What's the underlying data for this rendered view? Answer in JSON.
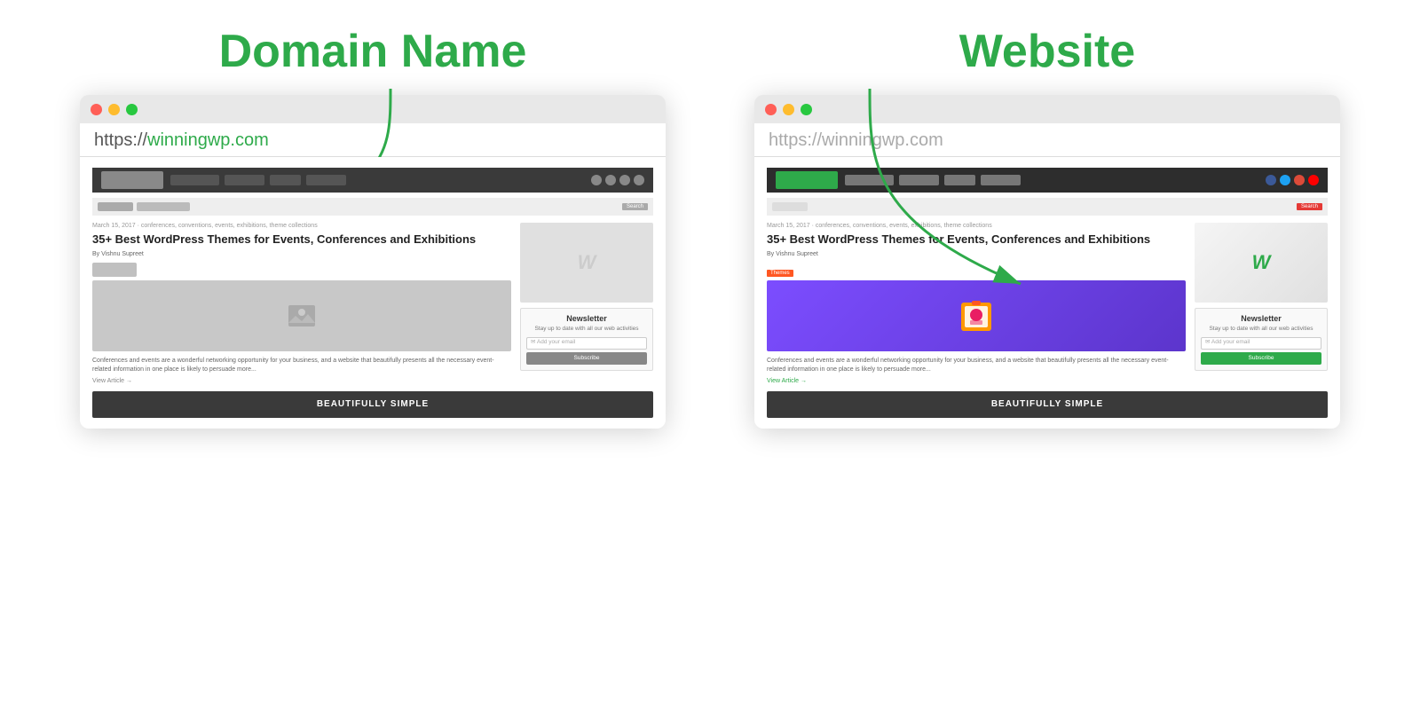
{
  "page": {
    "background": "#ffffff"
  },
  "left": {
    "title": "Domain Name",
    "url_prefix": "https://",
    "url_domain": "winningwp.com",
    "url_full": "https://winningwp.com",
    "article_meta": "March 15, 2017 · conferences, conventions, events, exhibitions, theme collections",
    "article_title": "35+ Best WordPress Themes for Events, Conferences and Exhibitions",
    "article_author": "By Vishnu Supreet",
    "article_excerpt": "Conferences and events are a wonderful networking opportunity for your business, and a website\nthat beautifully presents all the necessary event-related information in one place is likely to\npersuade more...",
    "view_article": "View Article →",
    "newsletter_title": "Newsletter",
    "newsletter_sub": "Stay up to date with all our web activities",
    "newsletter_placeholder": "✉ Add your email",
    "newsletter_btn": "Subscribe",
    "bottom_banner": "BEAUTIFULLY\nSIMPLE"
  },
  "right": {
    "title": "Website",
    "url_prefix": "https://",
    "url_domain": "winningwp.com",
    "url_full": "https://winningwp.com",
    "article_meta": "March 15, 2017 · conferences, conventions, events, exhibitions, theme collections",
    "article_title": "35+ Best WordPress Themes for Events, Conferences and Exhibitions",
    "article_author": "By Vishnu Supreet",
    "themes_badge": "Themes",
    "article_excerpt": "Conferences and events are a wonderful networking opportunity for your business, and a website\nthat beautifully presents all the necessary event-related information in one place is likely to\npersuade more...",
    "view_article": "View Article →",
    "newsletter_title": "Newsletter",
    "newsletter_sub": "Stay up to date with all our web activities",
    "newsletter_placeholder": "✉ Add your email",
    "newsletter_btn": "Subscribe",
    "bottom_banner": "BEAUTIFULLY\nSIMPLE",
    "search_btn": "Search"
  },
  "arrow": {
    "color": "#2eaa4a"
  }
}
